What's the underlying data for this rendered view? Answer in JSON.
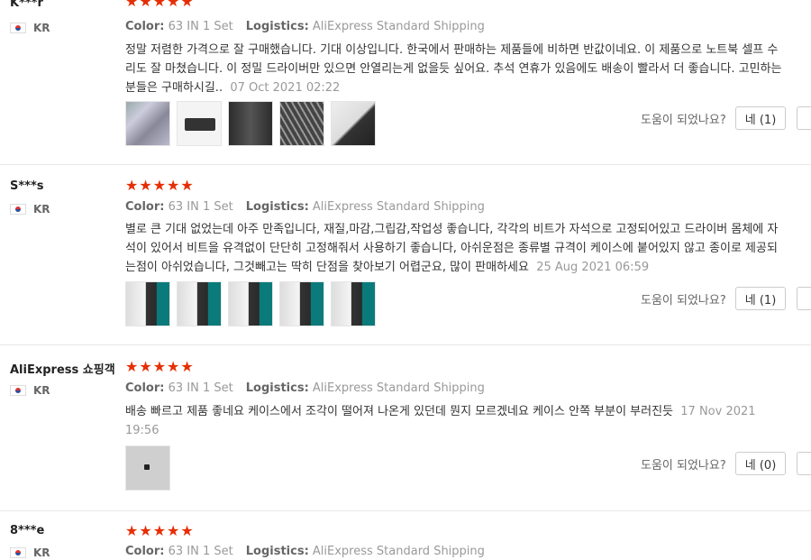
{
  "reviews": [
    {
      "user": "K***r",
      "country": "KR",
      "stars": "★★★★★",
      "color_label": "Color:",
      "color_value": "63 IN 1 Set",
      "logistics_label": "Logistics:",
      "logistics_value": "AliExpress Standard Shipping",
      "text": "정말 저렴한 가격으로 잘 구매했습니다. 기대 이상입니다. 한국에서 판매하는 제품들에 비하면 반값이네요. 이 제품으로 노트북 셀프 수리도 잘 마쳤습니다. 이 정밀 드라이버만 있으면 안열리는게 없을듯 싶어요. 추석 연휴가 있음에도 배송이 빨라서 더 좋습니다. 고민하는 분들은 구매하시길..",
      "date": "07 Oct 2021 02:22",
      "photos": [
        "screwdriver-bits-photo",
        "case-closed-photo",
        "case-open-photo",
        "bits-row-photo",
        "screwdriver-tip-photo"
      ],
      "helpful_question": "도움이 되었나요?",
      "yes_label": "네 (1)"
    },
    {
      "user": "S***s",
      "country": "KR",
      "stars": "★★★★★",
      "color_label": "Color:",
      "color_value": "63 IN 1 Set",
      "logistics_label": "Logistics:",
      "logistics_value": "AliExpress Standard Shipping",
      "text": "별로 큰 기대 없었는데 아주 만족입니다, 재질,마감,그립감,작업성 좋습니다, 각각의 비트가 자석으로 고정되어있고 드라이버 몸체에 자석이 있어서 비트을 유격없이 단단히 고정해줘서 사용하기 좋습니다, 아쉬운점은 종류별 규격이 케이스에 붙어있지 않고 종이로 제공되는점이 아쉬었습니다, 그것빼고는 딱히 단점을 찾아보기 어렵군요, 많이 판매하세요",
      "date": "25 Aug 2021 06:59",
      "photos": [
        "case-photo-1",
        "case-photo-2",
        "case-photo-3",
        "case-photo-4",
        "case-photo-5"
      ],
      "helpful_question": "도움이 되었나요?",
      "yes_label": "네 (1)"
    },
    {
      "user": "AliExpress 쇼핑객",
      "country": "KR",
      "stars": "★★★★★",
      "color_label": "Color:",
      "color_value": "63 IN 1 Set",
      "logistics_label": "Logistics:",
      "logistics_value": "AliExpress Standard Shipping",
      "text": "배송 빠르고 제품 좋네요 케이스에서 조각이 떨어져 나온게 있던데 뭔지 모르겠네요 케이스 안쪽 부분이 부러진듯",
      "date": "17 Nov 2021 19:56",
      "photos": [
        "broken-piece-photo"
      ],
      "helpful_question": "도움이 되었나요?",
      "yes_label": "네 (0)"
    },
    {
      "user": "8***e",
      "country": "KR",
      "stars": "★★★★★",
      "color_label": "Color:",
      "color_value": "63 IN 1 Set",
      "logistics_label": "Logistics:",
      "logistics_value": "AliExpress Standard Shipping"
    }
  ],
  "colors": {
    "star": "#e62e04",
    "divider": "#e8e8e8",
    "muted": "#999999"
  }
}
